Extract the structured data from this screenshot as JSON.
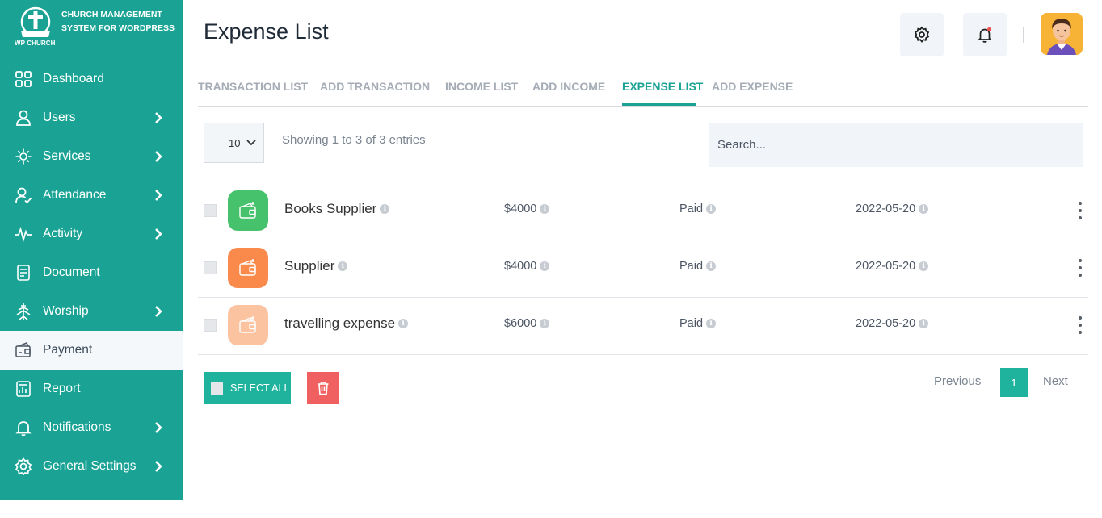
{
  "brand": {
    "logo_text": "WP CHURCH",
    "name": "CHURCH MANAGEMENT SYSTEM FOR WORDPRESS"
  },
  "sidebar": {
    "items": [
      {
        "label": "Dashboard",
        "icon": "grid-icon",
        "has_submenu": false
      },
      {
        "label": "Users",
        "icon": "user-icon",
        "has_submenu": true
      },
      {
        "label": "Services",
        "icon": "services-icon",
        "has_submenu": true
      },
      {
        "label": "Attendance",
        "icon": "attendance-icon",
        "has_submenu": true
      },
      {
        "label": "Activity",
        "icon": "activity-icon",
        "has_submenu": true
      },
      {
        "label": "Document",
        "icon": "document-icon",
        "has_submenu": false
      },
      {
        "label": "Worship",
        "icon": "worship-icon",
        "has_submenu": true
      },
      {
        "label": "Payment",
        "icon": "payment-icon",
        "has_submenu": false,
        "active": true
      },
      {
        "label": "Report",
        "icon": "report-icon",
        "has_submenu": false
      },
      {
        "label": "Notifications",
        "icon": "bell-icon",
        "has_submenu": true
      },
      {
        "label": "General Settings",
        "icon": "gear-icon",
        "has_submenu": true
      }
    ]
  },
  "header": {
    "title": "Expense List",
    "settings_icon": "gear-icon",
    "notification_icon": "bell-icon",
    "avatar": "user-avatar"
  },
  "tabs": [
    {
      "label": "TRANSACTION LIST"
    },
    {
      "label": "ADD TRANSACTION"
    },
    {
      "label": "INCOME LIST"
    },
    {
      "label": "ADD INCOME"
    },
    {
      "label": "EXPENSE LIST",
      "active": true
    },
    {
      "label": "ADD EXPENSE"
    }
  ],
  "table": {
    "page_size": "10",
    "showing_text": "Showing 1 to 3 of 3 entries",
    "search_placeholder": "Search...",
    "rows": [
      {
        "name": "Books Supplier",
        "amount": "$4000",
        "status": "Paid",
        "date": "2022-05-20",
        "icon_color": "#47c26c"
      },
      {
        "name": "Supplier",
        "amount": "$4000",
        "status": "Paid",
        "date": "2022-05-20",
        "icon_color": "#f98a4c"
      },
      {
        "name": "travelling expense",
        "amount": "$6000",
        "status": "Paid",
        "date": "2022-05-20",
        "icon_color": "#fcc3a1"
      }
    ]
  },
  "actions": {
    "select_all_label": "SELECT ALL",
    "delete_icon": "trash-icon"
  },
  "pagination": {
    "previous": "Previous",
    "current_page": "1",
    "next": "Next"
  },
  "colors": {
    "primary": "#1aa394",
    "accent": "#1fb39e",
    "danger": "#f06060"
  }
}
